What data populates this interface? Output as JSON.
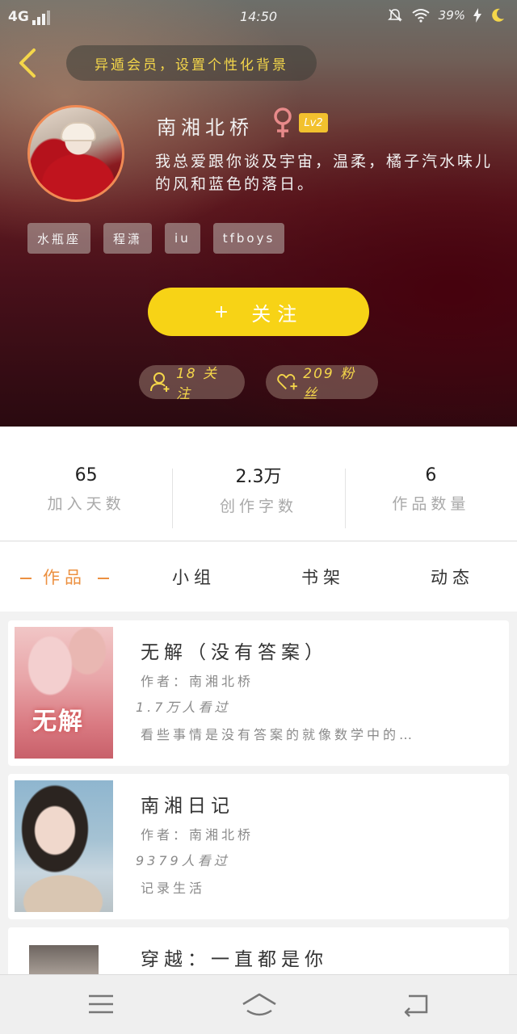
{
  "status_bar": {
    "network": "4G",
    "time": "14:50",
    "battery": "39%"
  },
  "header": {
    "banner_text": "异遁会员，设置个性化背景"
  },
  "profile": {
    "name": "南湘北桥",
    "level": "Lv2",
    "bio": "我总爱跟你谈及宇宙，温柔，橘子汽水味儿的风和蓝色的落日。",
    "tags": [
      "水瓶座",
      "程潇",
      "iu",
      "tfboys"
    ],
    "follow_label": "关注",
    "following": "18 关注",
    "fans": "209 粉丝"
  },
  "stats": [
    {
      "value": "65",
      "label": "加入天数"
    },
    {
      "value": "2.3万",
      "label": "创作字数"
    },
    {
      "value": "6",
      "label": "作品数量"
    }
  ],
  "tabs": [
    {
      "label": "作品",
      "active": true
    },
    {
      "label": "小组",
      "active": false
    },
    {
      "label": "书架",
      "active": false
    },
    {
      "label": "动态",
      "active": false
    }
  ],
  "works": [
    {
      "title": "无解（没有答案）",
      "author": "作者：南湘北桥",
      "views": "1.7万人看过",
      "description": "看些事情是没有答案的就像数学中的…",
      "cover_text": "无解"
    },
    {
      "title": "南湘日记",
      "author": "作者：南湘北桥",
      "views": "9379人看过",
      "description": "记录生活"
    },
    {
      "title": "穿越：一直都是你"
    }
  ],
  "colors": {
    "accent_yellow": "#f7d316",
    "tab_active": "#ec9040",
    "avatar_border": "#f08a54"
  }
}
